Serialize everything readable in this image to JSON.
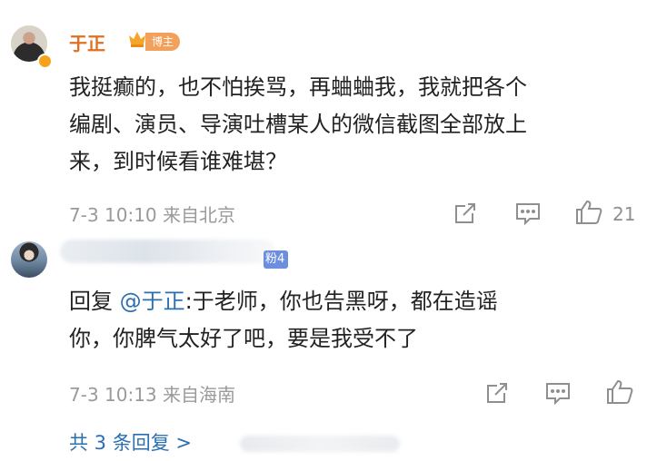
{
  "comment": {
    "username": "于正",
    "badge": "博主",
    "text_lines": [
      "我挺癫的，也不怕挨骂，再蛐蛐我，我就把各个",
      "编剧、演员、导演吐槽某人的微信截图全部放上",
      "来，到时候看谁难堪？"
    ],
    "time": "7-3 10:10",
    "location": "来自北京",
    "like_count": "21"
  },
  "reply": {
    "fan_badge": "粉4",
    "prefix": "回复 ",
    "mention": "@于正",
    "text_line1_rest": ":于老师，你也告黑呀，都在造谣",
    "text_line2": "你，你脾气太好了吧，要是我受不了",
    "time": "7-3 10:13",
    "location": "来自海南"
  },
  "more_replies": "共 3 条回复 >",
  "icons": {
    "share": "share-icon",
    "comment": "comment-icon",
    "like": "thumbs-up-icon"
  },
  "colors": {
    "username": "#e0701e",
    "link": "#2a6fb1",
    "meta": "#9a9a9a"
  }
}
